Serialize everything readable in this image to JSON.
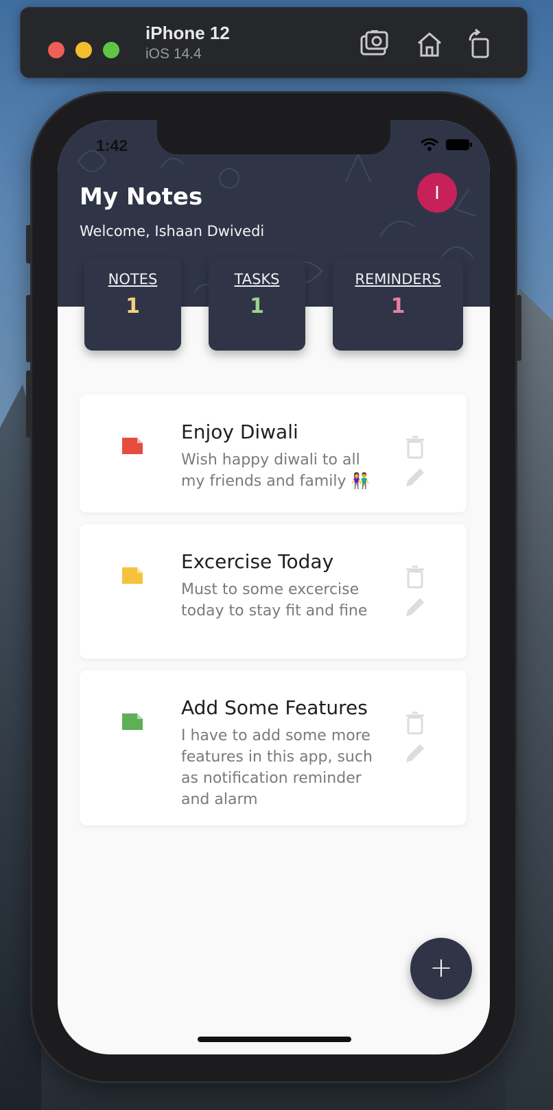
{
  "simulator": {
    "device": "iPhone 12",
    "os": "iOS 14.4",
    "buttons": [
      {
        "icon": "screenshot-icon"
      },
      {
        "icon": "home-icon"
      },
      {
        "icon": "rotate-icon"
      }
    ]
  },
  "status_bar": {
    "time": "1:42"
  },
  "header": {
    "title": "My Notes",
    "welcome": "Welcome, Ishaan Dwivedi",
    "avatar_initial": "I",
    "avatar_color": "#c8215a"
  },
  "stats": [
    {
      "label": "NOTES",
      "count": "1",
      "color": "#f2d27a"
    },
    {
      "label": "TASKS",
      "count": "1",
      "color": "#9bd48a"
    },
    {
      "label": "REMINDERS",
      "count": "1",
      "color": "#e87ea6"
    }
  ],
  "notes": [
    {
      "title": "Enjoy Diwali",
      "body": "Wish happy diwali to all my friends and family 👫",
      "color": "#e44d3f"
    },
    {
      "title": "Excercise Today",
      "body": "Must to some excercise today to stay fit and fine",
      "color": "#f6c23e"
    },
    {
      "title": "Add Some Features",
      "body": "I have to add some more features in this app, such as notification reminder and alarm",
      "color": "#5fae58"
    }
  ],
  "fab": {
    "label": "+"
  },
  "colors": {
    "primary": "#2f3547",
    "background": "#f9f9f9"
  }
}
